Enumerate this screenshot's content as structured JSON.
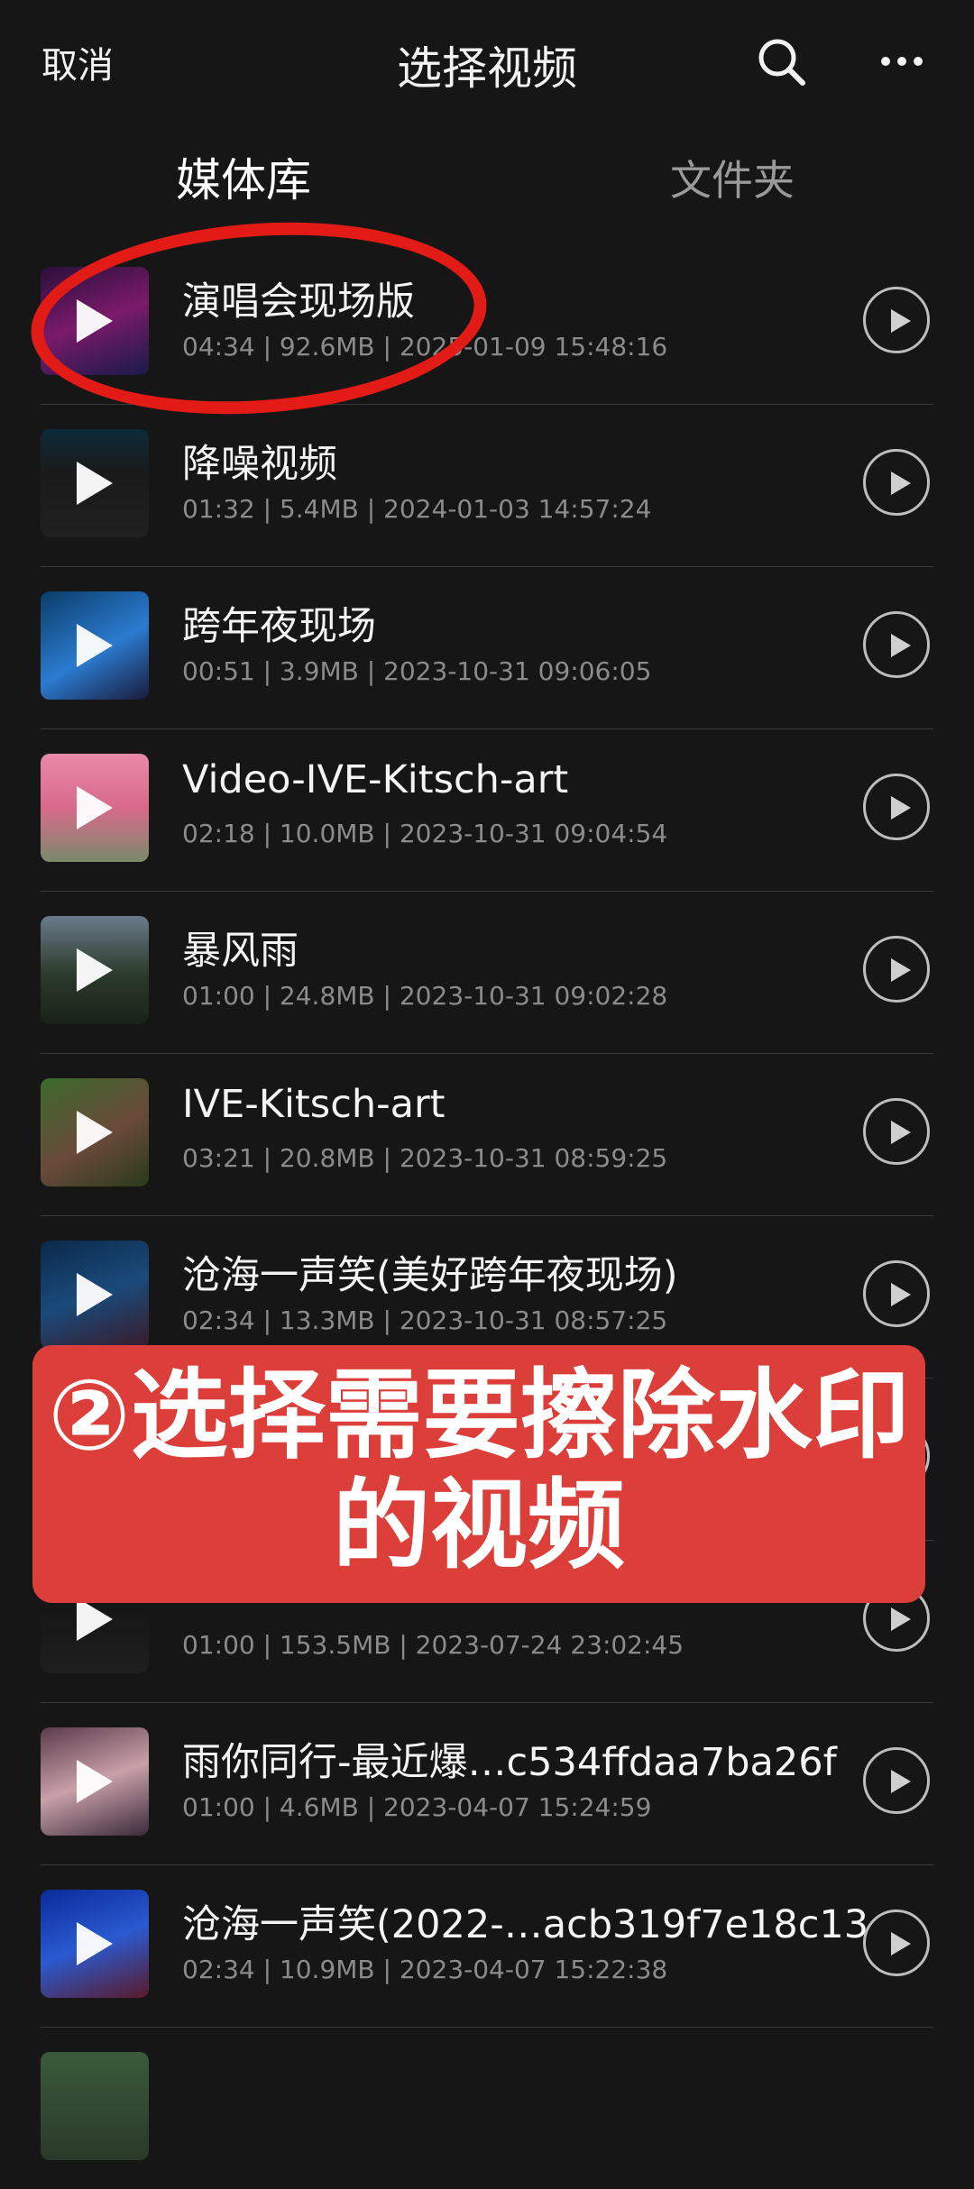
{
  "header": {
    "cancel_label": "取消",
    "title": "选择视频"
  },
  "tabs": [
    {
      "label": "媒体库"
    },
    {
      "label": "文件夹"
    }
  ],
  "videos": [
    {
      "name": "演唱会现场版",
      "meta": "04:34 | 92.6MB | 2025-01-09 15:48:16"
    },
    {
      "name": "降噪视频",
      "meta": "01:32 | 5.4MB | 2024-01-03 14:57:24"
    },
    {
      "name": "跨年夜现场",
      "meta": "00:51 | 3.9MB | 2023-10-31 09:06:05"
    },
    {
      "name": "Video-IVE-Kitsch-art",
      "meta": "02:18 | 10.0MB | 2023-10-31 09:04:54"
    },
    {
      "name": "暴风雨",
      "meta": "01:00 | 24.8MB | 2023-10-31 09:02:28"
    },
    {
      "name": "IVE-Kitsch-art",
      "meta": "03:21 | 20.8MB | 2023-10-31 08:59:25"
    },
    {
      "name": "沧海一声笑(美好跨年夜现场)",
      "meta": "02:34 | 13.3MB | 2023-10-31 08:57:25"
    },
    {
      "name": "",
      "meta": ""
    },
    {
      "name": "",
      "meta": "01:00 | 153.5MB | 2023-07-24 23:02:45"
    },
    {
      "name": "雨你同行-最近爆…c534ffdaa7ba26f",
      "meta": "01:00 | 4.6MB | 2023-04-07 15:24:59"
    },
    {
      "name": "沧海一声笑(2022-…acb319f7e18c13",
      "meta": "02:34 | 10.9MB | 2023-04-07 15:22:38"
    }
  ],
  "annotation": {
    "banner_text": "②选择需要擦除水印的视频"
  },
  "colors": {
    "background": "#161616",
    "banner": "#dc3f3a",
    "circle": "#e21b16"
  }
}
